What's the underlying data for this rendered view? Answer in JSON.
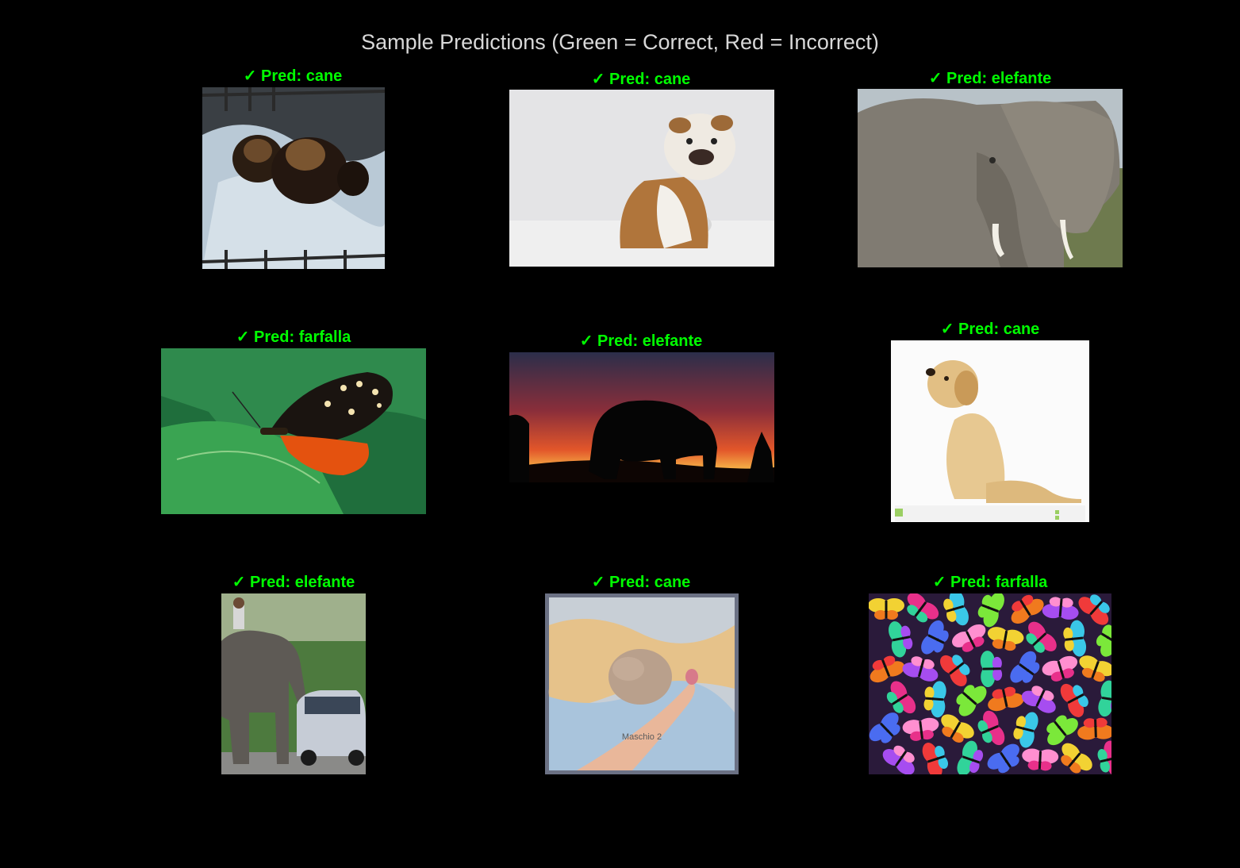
{
  "title": "Sample Predictions (Green = Correct, Red = Incorrect)",
  "colors": {
    "correct": "#00ff00",
    "incorrect": "#ff0000",
    "background": "#000000"
  },
  "samples": [
    {
      "label": "✓ Pred: cane",
      "correct": true,
      "subject": "yorkie-puppies-photo"
    },
    {
      "label": "✓ Pred: cane",
      "correct": true,
      "subject": "bulldog-photo"
    },
    {
      "label": "✓ Pred: elefante",
      "correct": true,
      "subject": "elephant-closeup-photo"
    },
    {
      "label": "✓ Pred: farfalla",
      "correct": true,
      "subject": "butterfly-on-leaf-photo"
    },
    {
      "label": "✓ Pred: elefante",
      "correct": true,
      "subject": "elephant-sunset-silhouette-photo"
    },
    {
      "label": "✓ Pred: cane",
      "correct": true,
      "subject": "golden-puppy-photo"
    },
    {
      "label": "✓ Pred: elefante",
      "correct": true,
      "subject": "elephant-with-car-photo"
    },
    {
      "label": "✓ Pred: cane",
      "correct": true,
      "subject": "newborn-puppy-in-hand-photo",
      "watermark": "Maschio 2"
    },
    {
      "label": "✓ Pred: farfalla",
      "correct": true,
      "subject": "colorful-butterflies-photo"
    }
  ]
}
